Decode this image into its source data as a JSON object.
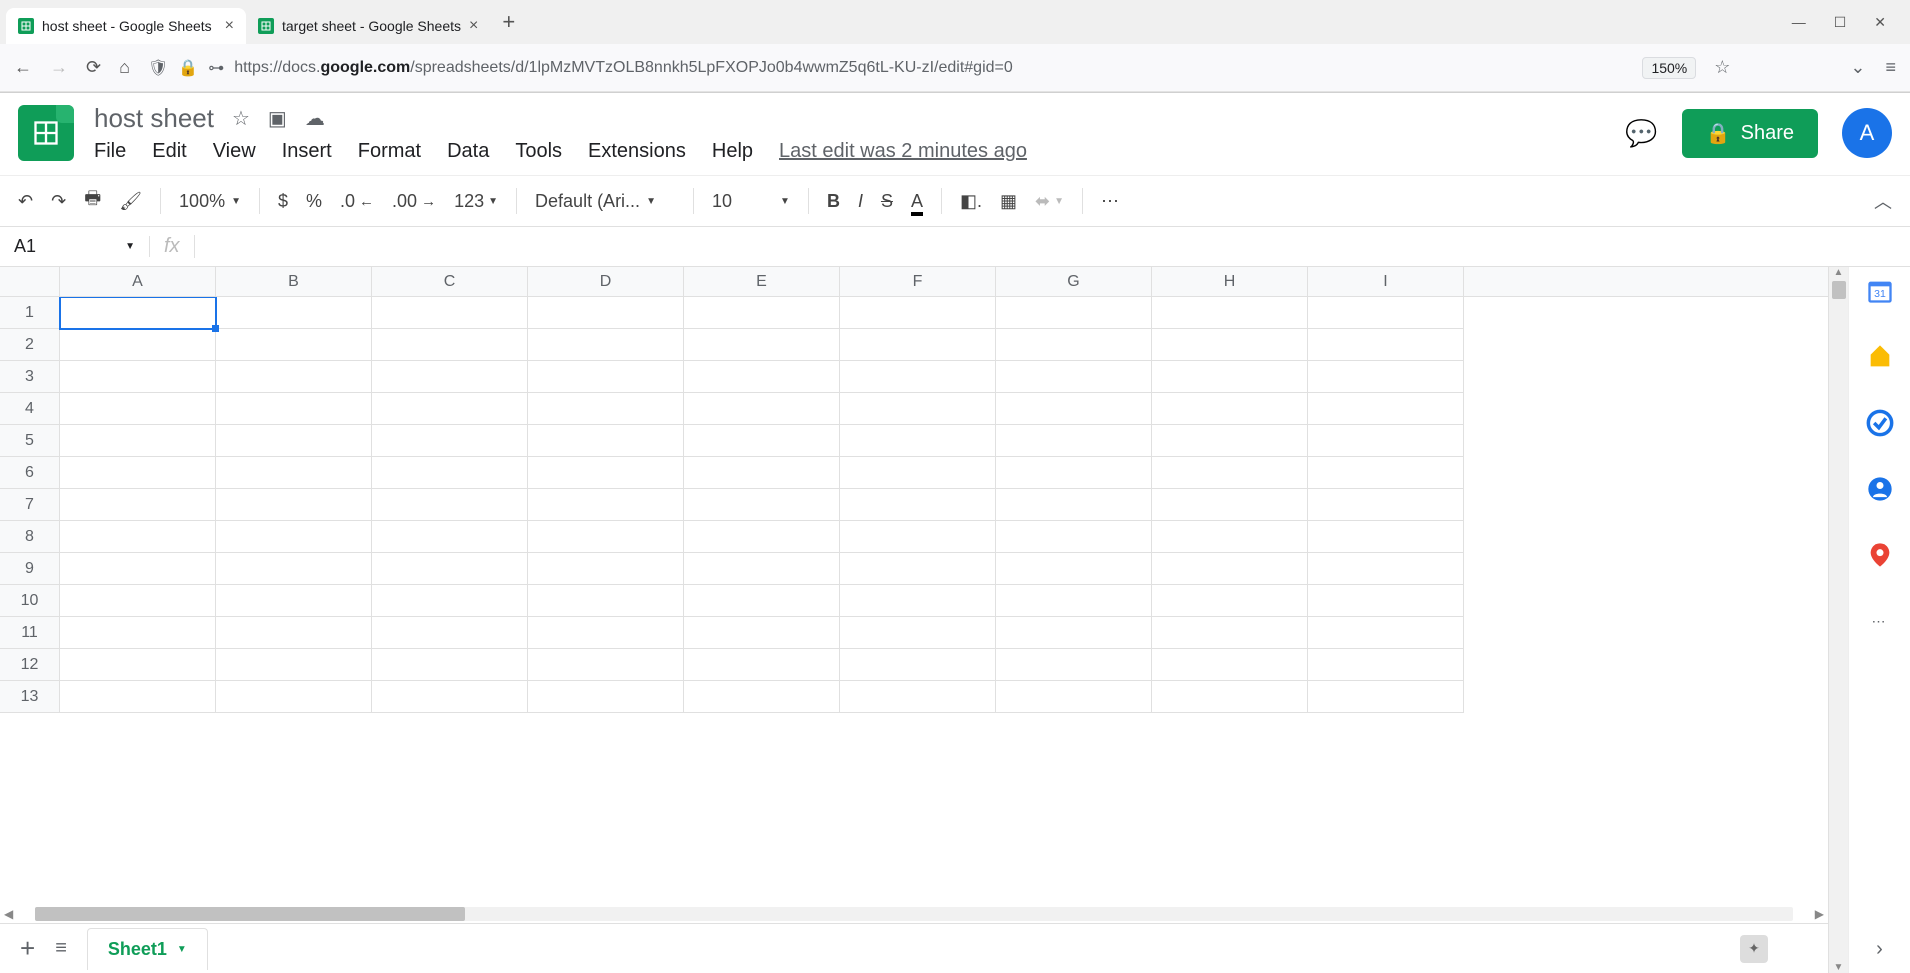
{
  "browser": {
    "tabs": [
      {
        "title": "host sheet - Google Sheets",
        "active": true
      },
      {
        "title": "target sheet - Google Sheets",
        "active": false
      }
    ],
    "url_prefix": "https://docs.",
    "url_host": "google.com",
    "url_suffix": "/spreadsheets/d/1lpMzMVTzOLB8nnkh5LpFXOPJo0b4wwmZ5q6tL-KU-zI/edit#gid=0",
    "zoom": "150%"
  },
  "doc": {
    "title": "host sheet",
    "last_edit": "Last edit was 2 minutes ago",
    "share_label": "Share",
    "avatar_initial": "A"
  },
  "menus": [
    "File",
    "Edit",
    "View",
    "Insert",
    "Format",
    "Data",
    "Tools",
    "Extensions",
    "Help"
  ],
  "toolbar": {
    "zoom": "100%",
    "currency": "$",
    "percent": "%",
    "dec_dec": ".0",
    "inc_dec": ".00",
    "num_fmt": "123",
    "font": "Default (Ari...",
    "font_size": "10"
  },
  "name_box": "A1",
  "columns": [
    "A",
    "B",
    "C",
    "D",
    "E",
    "F",
    "G",
    "H",
    "I"
  ],
  "rows": [
    "1",
    "2",
    "3",
    "4",
    "5",
    "6",
    "7",
    "8",
    "9",
    "10",
    "11",
    "12",
    "13"
  ],
  "selected_cell": {
    "row": 0,
    "col": 0
  },
  "sheet_tab": "Sheet1"
}
